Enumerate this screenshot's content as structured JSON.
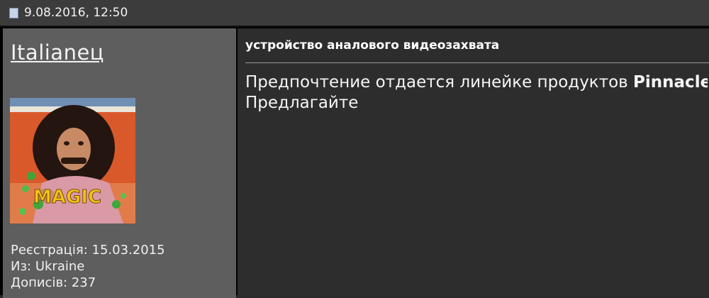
{
  "post": {
    "date": "9.08.2016, 12:50"
  },
  "user": {
    "name": "Italianeц",
    "avatar_text": "MAGIC",
    "registration": "Реєстрація: 15.03.2015",
    "from": "Из: Ukraine",
    "posts": "Дописів: 237"
  },
  "message": {
    "title": "устройство аналового видеозахвата",
    "line1_prefix": "Предпочтение отдается линейке продуктов ",
    "line1_bold": "Pinnacle",
    "line2": "Предлагайте"
  },
  "colors": {
    "header_bg": "#3c3c3c",
    "userinfo_bg": "#5e5e5e",
    "content_bg": "#2d2d2d"
  }
}
